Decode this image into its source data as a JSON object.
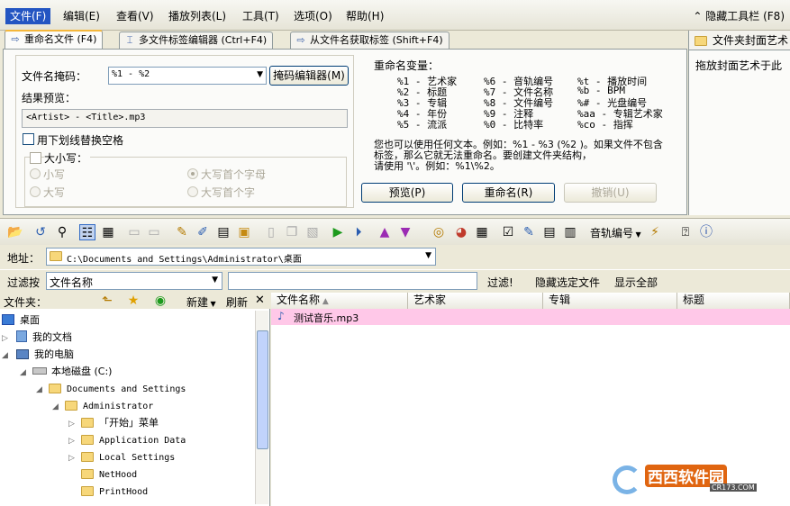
{
  "menubar": {
    "items": [
      "文件(F)",
      "编辑(E)",
      "查看(V)",
      "播放列表(L)",
      "工具(T)",
      "选项(O)",
      "帮助(H)"
    ],
    "hide_toolbar": "隐藏工具栏 (F8)"
  },
  "tabs": [
    "重命名文件 (F4)",
    "多文件标签编辑器 (Ctrl+F4)",
    "从文件名获取标签 (Shift+F4)"
  ],
  "rename": {
    "mask_label": "文件名掩码：",
    "mask_value": "%1 - %2",
    "mask_editor_btn": "掩码编辑器(M)",
    "preview_label": "结果预览：",
    "preview_value": "<Artist> - <Title>.mp3",
    "underscore_label": "用下划线替换空格",
    "case_label": "大小写：",
    "case_options": [
      "小写",
      "大写",
      "大写首个字母",
      "大写首个字"
    ],
    "vars_title": "重命名变量：",
    "vars_col1": [
      "%1 - 艺术家",
      "%2 - 标题",
      "%3 - 专辑",
      "%4 - 年份",
      "%5 - 流派"
    ],
    "vars_col2": [
      "%6 - 音轨编号",
      "%7 - 文件名称",
      "%8 - 文件编号",
      "%9 - 注释",
      "%0 - 比特率"
    ],
    "vars_col3": [
      "%t - 播放时间",
      "%b - BPM",
      "%# - 光盘编号",
      "%aa - 专辑艺术家",
      "%co - 指挥"
    ],
    "note1": "您也可以使用任何文本。例如：%1 - %3 (%2 )。如果文件不包含",
    "note2": "标签，那么它就无法重命名。要创建文件夹结构，",
    "note3": "请使用 '\\'。例如：%1\\%2。",
    "preview_btn": "预览(P)",
    "rename_btn": "重命名(R)",
    "undo_btn": "撤销(U)"
  },
  "right_panel": {
    "title": "文件夹封面艺术",
    "text": "拖放封面艺术于此"
  },
  "toolbar": {
    "track_label": "音轨编号"
  },
  "address": {
    "label": "地址：",
    "value": "C:\\Documents and Settings\\Administrator\\桌面"
  },
  "filter": {
    "label": "过滤按",
    "field": "文件名称",
    "filter_btn": "过滤!",
    "hide_btn": "隐藏选定文件",
    "show_all_btn": "显示全部"
  },
  "folder_pane": {
    "label": "文件夹：",
    "new_btn": "新建",
    "refresh_btn": "刷新"
  },
  "tree": [
    {
      "label": "桌面"
    },
    {
      "label": "我的文档"
    },
    {
      "label": "我的电脑"
    },
    {
      "label": "本地磁盘 (C:)"
    },
    {
      "label": "Documents and Settings"
    },
    {
      "label": "Administrator"
    },
    {
      "label": "「开始」菜单"
    },
    {
      "label": "Application Data"
    },
    {
      "label": "Local Settings"
    },
    {
      "label": "NetHood"
    },
    {
      "label": "PrintHood"
    }
  ],
  "columns": [
    "文件名称",
    "艺术家",
    "专辑",
    "标题"
  ],
  "files": [
    {
      "name": "测试音乐.mp3"
    }
  ],
  "watermark": {
    "text": "西西软件园",
    "sub": "CR173.COM"
  }
}
